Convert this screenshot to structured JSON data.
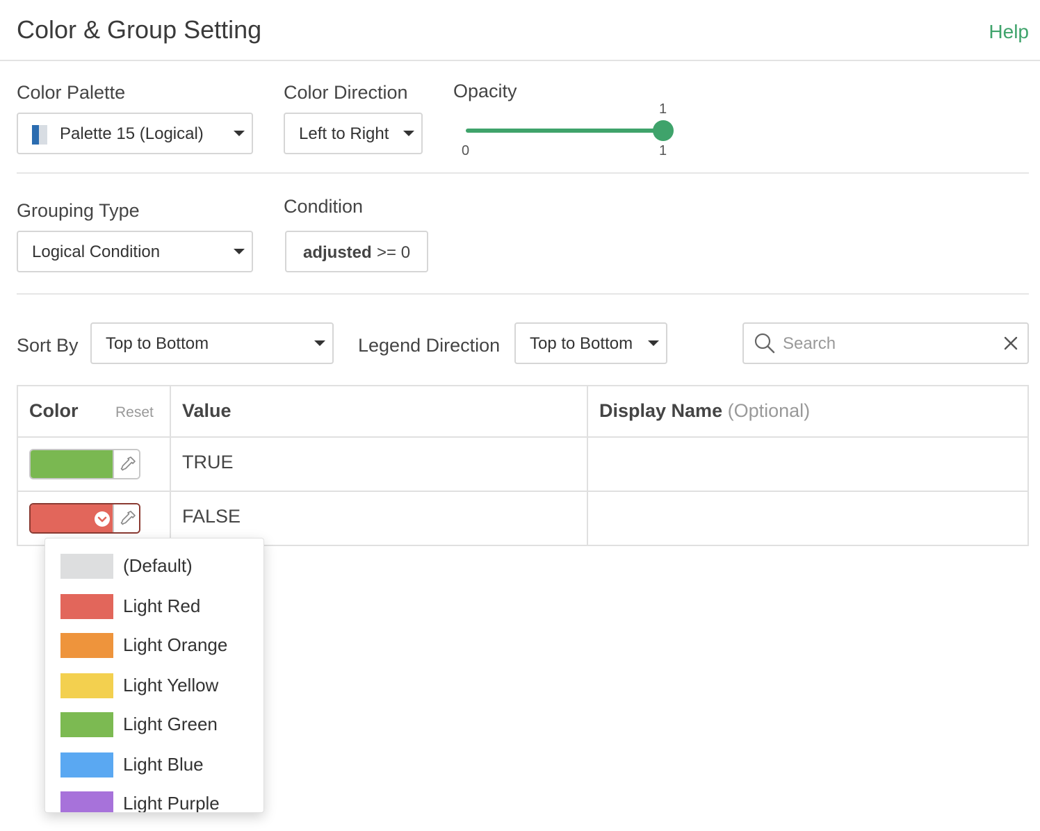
{
  "header": {
    "title": "Color & Group Setting",
    "help": "Help"
  },
  "color_palette": {
    "label": "Color Palette",
    "value": "Palette 15 (Logical)"
  },
  "color_direction": {
    "label": "Color Direction",
    "value": "Left to Right"
  },
  "opacity": {
    "label": "Opacity",
    "min": "0",
    "max": "1",
    "value": "1",
    "fraction": 1.0
  },
  "grouping_type": {
    "label": "Grouping Type",
    "value": "Logical Condition"
  },
  "condition": {
    "label": "Condition",
    "field": "adjusted",
    "expr": ">= 0"
  },
  "sort_by": {
    "label": "Sort By",
    "value": "Top to Bottom"
  },
  "legend_direction": {
    "label": "Legend Direction",
    "value": "Top to Bottom"
  },
  "search": {
    "placeholder": "Search"
  },
  "table": {
    "headers": {
      "color": "Color",
      "reset": "Reset",
      "value": "Value",
      "display_name": "Display Name",
      "optional": "(Optional)"
    },
    "rows": [
      {
        "value": "TRUE",
        "color": "#7ab851",
        "display_name": ""
      },
      {
        "value": "FALSE",
        "color": "#e2665b",
        "display_name": ""
      }
    ]
  },
  "color_menu": {
    "items": [
      {
        "label": "(Default)",
        "color": "#dddedf"
      },
      {
        "label": "Light Red",
        "color": "#e2665b"
      },
      {
        "label": "Light Orange",
        "color": "#ee943c"
      },
      {
        "label": "Light Yellow",
        "color": "#f3d04f"
      },
      {
        "label": "Light Green",
        "color": "#7cba52"
      },
      {
        "label": "Light Blue",
        "color": "#5aa8f2"
      },
      {
        "label": "Light Purple",
        "color": "#a772da"
      }
    ]
  },
  "colors": {
    "accent": "#3fa36b",
    "palette_icon": [
      "#2b6cb0",
      "#d8dde3"
    ]
  }
}
